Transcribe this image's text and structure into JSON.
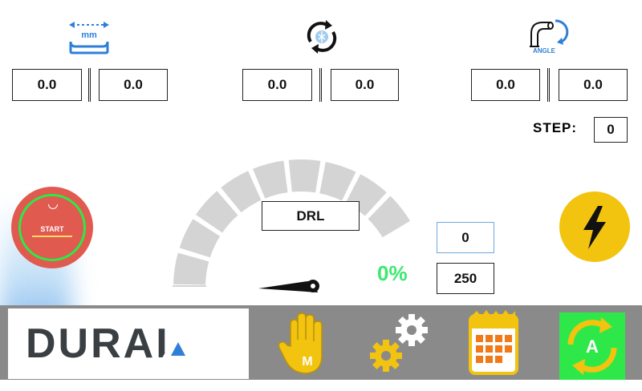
{
  "top_groups": [
    {
      "icon": "mm-width-icon",
      "icon_label": "mm",
      "values": [
        "0.0",
        "0.0"
      ]
    },
    {
      "icon": "rotation-icon",
      "values": [
        "0.0",
        "0.0"
      ]
    },
    {
      "icon": "angle-icon",
      "icon_label": "ANGLE",
      "values": [
        "0.0",
        "0.0"
      ]
    }
  ],
  "step": {
    "label": "STEP:",
    "value": "0"
  },
  "start_button": {
    "label": "START"
  },
  "gauge": {
    "mode": "DRL",
    "percent_text": "0%",
    "current": "0",
    "max": "250",
    "percent_value": 0
  },
  "toolbar": {
    "logo": "DURAL",
    "manual_icon_letter": "M",
    "auto_icon_letter": "A"
  },
  "colors": {
    "accent_yellow": "#f2c30f",
    "start_red": "#e05a4f",
    "ring_green": "#2ee84a",
    "percent_green": "#3ee870",
    "toolbar_gray": "#8a8a8a",
    "gauge_gray": "#d4d4d4"
  }
}
